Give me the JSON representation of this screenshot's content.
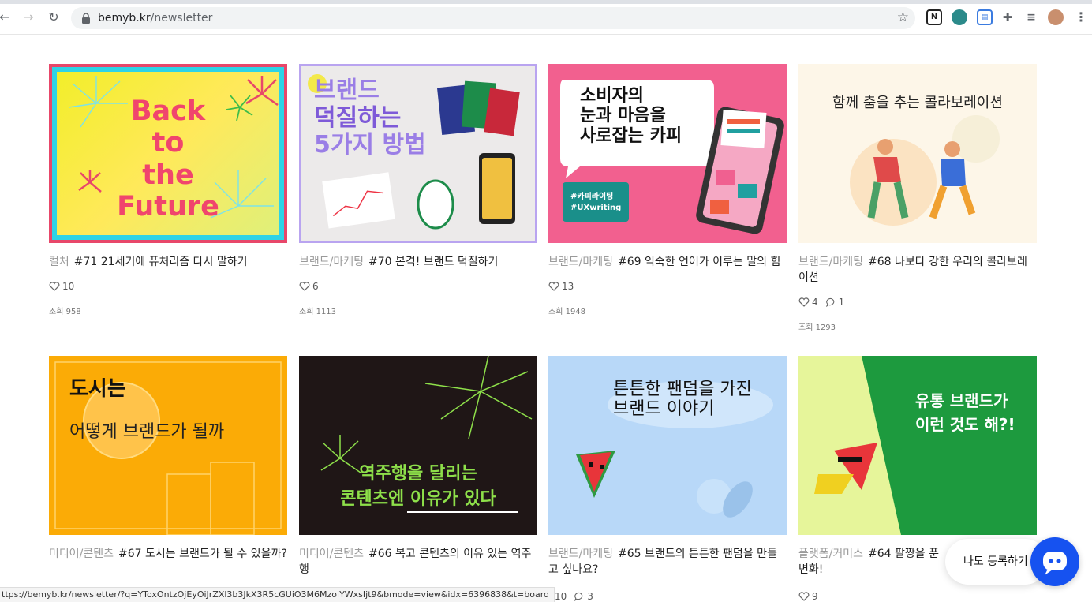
{
  "browser": {
    "url_domain": "bemyb.kr",
    "url_path": "/newsletter"
  },
  "cards": [
    {
      "category": "컬처",
      "title": "#71 21세기에 퓨처리즘 다시 말하기",
      "likes": "10",
      "comments": "",
      "views": "조회 958",
      "thumb_lines": [
        "Back",
        "to",
        "the",
        "Future"
      ]
    },
    {
      "category": "브랜드/마케팅",
      "title": "#70 본격! 브랜드 덕질하기",
      "likes": "6",
      "comments": "",
      "views": "조회 1113",
      "thumb_lines": [
        "브랜드",
        "덕질하는",
        "5가지 방법"
      ]
    },
    {
      "category": "브랜드/마케팅",
      "title": "#69 익숙한 언어가 이루는 말의 힘",
      "likes": "13",
      "comments": "",
      "views": "조회 1948",
      "thumb_lines": [
        "소비자의",
        "눈과 마음을",
        "사로잡는 카피"
      ],
      "thumb_tags": [
        "#카피라이팅",
        "#UXwriting"
      ]
    },
    {
      "category": "브랜드/마케팅",
      "title": "#68 나보다 강한 우리의 콜라보레이션",
      "likes": "4",
      "comments": "1",
      "views": "조회 1293",
      "thumb_lines": [
        "함께 춤을 추는 콜라보레이션"
      ]
    },
    {
      "category": "미디어/콘텐츠",
      "title": "#67 도시는 브랜드가 될 수 있을까?",
      "likes": "",
      "comments": "",
      "views": "",
      "thumb_lines": [
        "도시는",
        "어떻게 브랜드가 될까"
      ]
    },
    {
      "category": "미디어/콘텐츠",
      "title": "#66 복고 콘텐츠의 이유 있는 역주행",
      "likes": "10",
      "comments": "3",
      "views": "",
      "thumb_lines": [
        "역주행을 달리는",
        "콘텐츠엔 이유가 있다"
      ]
    },
    {
      "category": "브랜드/마케팅",
      "title": "#65 브랜드의 튼튼한 팬덤을 만들고 싶나요?",
      "likes": "",
      "comments": "",
      "views": "",
      "thumb_lines": [
        "튼튼한 팬덤을 가진",
        "브랜드 이야기"
      ]
    },
    {
      "category": "플랫폼/커머스",
      "title": "#64 팔짱을 푼",
      "title_line2": "변화!",
      "likes": "9",
      "comments": "",
      "views": "",
      "thumb_lines": [
        "유통 브랜드가",
        "이런 것도 해?!"
      ]
    }
  ],
  "status_url": "ttps://bemyb.kr/newsletter/?q=YToxOntzOjEyOiJrZXl3b3JkX3R5cGUiO3M6MzoiYWxsIjt9&bmode=view&idx=6396838&t=board",
  "floating": {
    "register_label": "나도 등록하기"
  },
  "colors": {
    "chat_button": "#1652f0",
    "category_text": "#9a9a9a"
  }
}
